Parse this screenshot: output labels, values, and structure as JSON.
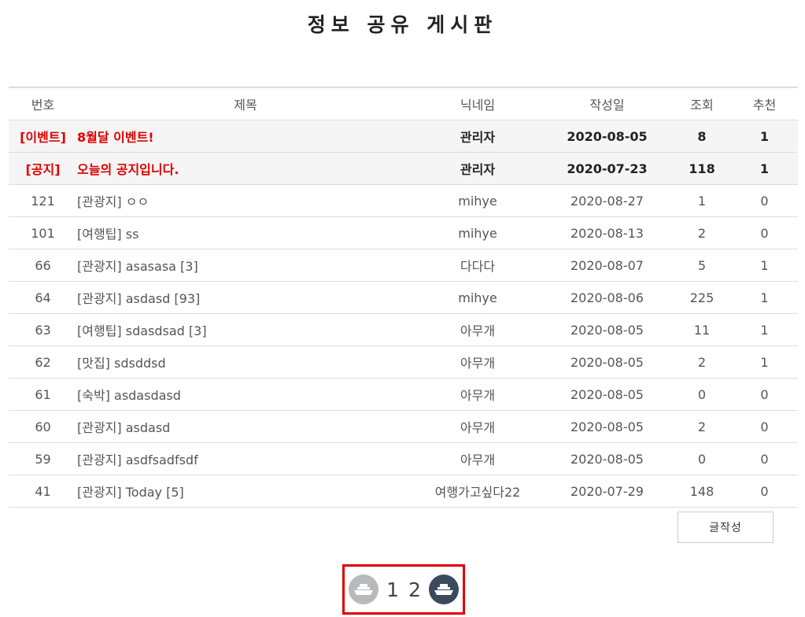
{
  "page": {
    "title": "정보 공유 게시판"
  },
  "table": {
    "headers": {
      "no": "번호",
      "title": "제목",
      "nickname": "닉네임",
      "date": "작성일",
      "views": "조회",
      "recommend": "추천"
    },
    "notices": [
      {
        "category": "[이벤트]",
        "title": "8월달 이벤트!",
        "nickname": "관리자",
        "date": "2020-08-05",
        "views": "8",
        "recommend": "1"
      },
      {
        "category": "[공지]",
        "title": "오늘의 공지입니다.",
        "nickname": "관리자",
        "date": "2020-07-23",
        "views": "118",
        "recommend": "1"
      }
    ],
    "rows": [
      {
        "no": "121",
        "title": "[관광지] ㅇㅇ",
        "nickname": "mihye",
        "date": "2020-08-27",
        "views": "1",
        "recommend": "0"
      },
      {
        "no": "101",
        "title": "[여행팁] ss",
        "nickname": "mihye",
        "date": "2020-08-13",
        "views": "2",
        "recommend": "0"
      },
      {
        "no": "66",
        "title": "[관광지] asasasa [3]",
        "nickname": "다다다",
        "date": "2020-08-07",
        "views": "5",
        "recommend": "1"
      },
      {
        "no": "64",
        "title": "[관광지] asdasd [93]",
        "nickname": "mihye",
        "date": "2020-08-06",
        "views": "225",
        "recommend": "1"
      },
      {
        "no": "63",
        "title": "[여행팁] sdasdsad [3]",
        "nickname": "아무개",
        "date": "2020-08-05",
        "views": "11",
        "recommend": "1"
      },
      {
        "no": "62",
        "title": "[맛집] sdsddsd",
        "nickname": "아무개",
        "date": "2020-08-05",
        "views": "2",
        "recommend": "1"
      },
      {
        "no": "61",
        "title": "[숙박] asdasdasd",
        "nickname": "아무개",
        "date": "2020-08-05",
        "views": "0",
        "recommend": "0"
      },
      {
        "no": "60",
        "title": "[관광지] asdasd",
        "nickname": "아무개",
        "date": "2020-08-05",
        "views": "2",
        "recommend": "0"
      },
      {
        "no": "59",
        "title": "[관광지] asdfsadfsdf",
        "nickname": "아무개",
        "date": "2020-08-05",
        "views": "0",
        "recommend": "0"
      },
      {
        "no": "41",
        "title": "[관광지] Today [5]",
        "nickname": "여행가고싶다22",
        "date": "2020-07-29",
        "views": "148",
        "recommend": "0"
      }
    ]
  },
  "actions": {
    "write_label": "글작성"
  },
  "pagination": {
    "prev_icon": "ship-icon",
    "next_icon": "ship-icon",
    "pages": [
      "1",
      "2"
    ],
    "colors": {
      "highlight_border": "#e00000",
      "prev_bg": "#b7b9bd",
      "next_bg": "#3c4a5e"
    }
  },
  "colors": {
    "notice_text": "#e00000",
    "notice_row_bg": "#f5f5f5"
  }
}
